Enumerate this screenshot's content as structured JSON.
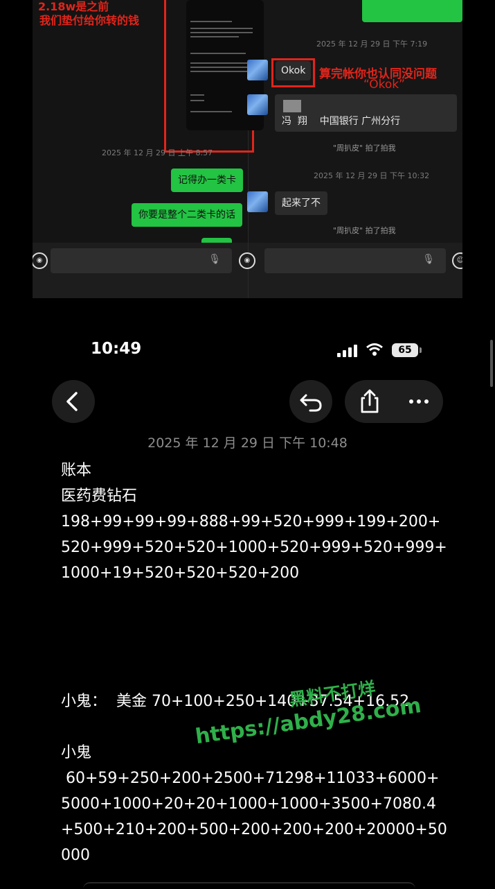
{
  "collage": {
    "left_red_note_1": "2.18w是之前",
    "left_red_note_2": "我们垫付给你转的钱",
    "left_timestamp": "2025 年 12 月 29 日 上午 8:57",
    "left_bubble_1": "记得办一类卡",
    "left_bubble_2": "你要是整个二类卡的话",
    "right_timestamp_1": "2025 年 12 月 29 日 下午 7:19",
    "okok_bubble": "Okok",
    "red_note_1": "算完帐你也认同没问题",
    "red_note_2": "“Okok”",
    "bank_card_text": "冯  翔    中国银行 广州分行",
    "pat_1": "\"周扒皮\" 拍了拍我",
    "right_timestamp_2": "2025 年 12 月 29 日 下午 10:32",
    "right_bubble": "起来了不",
    "pat_2": "\"周扒皮\" 拍了拍我"
  },
  "status": {
    "time": "10:49",
    "battery": "65"
  },
  "nav": {
    "back_icon": "chevron-left-icon",
    "undo_icon": "undo-icon",
    "share_icon": "share-icon",
    "more_icon": "more-icon"
  },
  "note": {
    "date": "2025 年 12 月 29 日 下午 10:48",
    "line1": "账本",
    "line2": "医药费钻石",
    "line3": "198+99+99+99+888+99+520+999+199+200+520+999+520+520+1000+520+999+520+999+1000+19+520+520+520+200",
    "line4": "小鬼：  美金 70+100+250+140+37.54+16.52",
    "line5": "小鬼",
    "line6": " 60+59+250+200+2500+71298+11033+6000+5000+1000+20+20+1000+1000+3500+7080.4+500+210+200+500+200+200+200+20000+50000"
  },
  "watermark": {
    "line1": "黑料不打烊",
    "line2": "https://abdy28.com"
  },
  "colors": {
    "wechat_green": "#23c343",
    "annotation_red": "#e1251b",
    "watermark_green": "#2fb04a"
  }
}
